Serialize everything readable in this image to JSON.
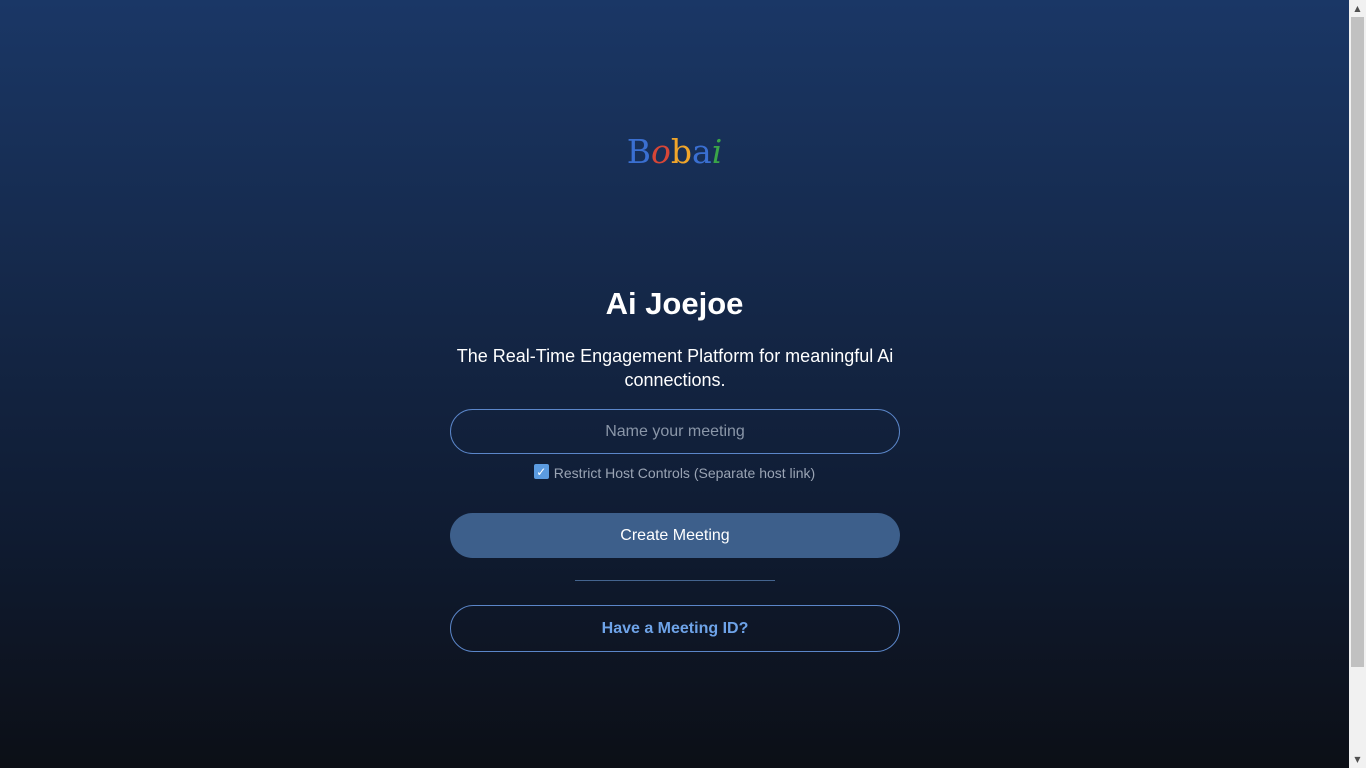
{
  "logo": {
    "letters": [
      "B",
      "o",
      "b",
      "a",
      "i"
    ],
    "colors": [
      "#3a6fd1",
      "#d64637",
      "#f0a52a",
      "#3a6fd1",
      "#3aa548"
    ]
  },
  "hero": {
    "title": "Ai Joejoe",
    "tagline": "The Real-Time Engagement Platform for meaningful Ai connections."
  },
  "form": {
    "meeting_name_placeholder": "Name your meeting",
    "meeting_name_value": "",
    "restrict_label": "Restrict Host Controls (Separate host link)",
    "restrict_checked": true,
    "create_button": "Create Meeting",
    "join_button": "Have a Meeting ID?"
  },
  "colors": {
    "background_top": "#1a3766",
    "background_bottom": "#0c0f16",
    "accent": "#5b86c9",
    "button_fill": "#3d5f8b"
  },
  "icons": {
    "checkbox": "check-icon"
  }
}
